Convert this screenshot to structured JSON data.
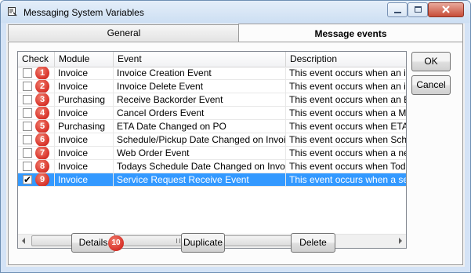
{
  "window": {
    "title": "Messaging System Variables"
  },
  "tabs": [
    {
      "label": "General",
      "active": false
    },
    {
      "label": "Message events",
      "active": true
    }
  ],
  "grid": {
    "columns": [
      "Check",
      "Module",
      "Event",
      "Description"
    ],
    "rows": [
      {
        "checked": false,
        "badge": "1",
        "module": "Invoice",
        "event": "Invoice Creation Event",
        "description": "This event occurs when an inv",
        "selected": false
      },
      {
        "checked": false,
        "badge": "2",
        "module": "Invoice",
        "event": "Invoice Delete Event",
        "description": "This event occurs when an inv",
        "selected": false
      },
      {
        "checked": false,
        "badge": "3",
        "module": "Purchasing",
        "event": "Receive Backorder Event",
        "description": "This event occurs when an Ba",
        "selected": false
      },
      {
        "checked": false,
        "badge": "4",
        "module": "Invoice",
        "event": "Cancel Orders Event",
        "description": "This event occurs when a Mo.",
        "selected": false
      },
      {
        "checked": false,
        "badge": "5",
        "module": "Purchasing",
        "event": "ETA Date Changed on PO",
        "description": "This event occurs when ETA .",
        "selected": false
      },
      {
        "checked": false,
        "badge": "6",
        "module": "Invoice",
        "event": "Schedule/Pickup Date Changed on Invoice",
        "description": "This event occurs when Sche.",
        "selected": false
      },
      {
        "checked": false,
        "badge": "7",
        "module": "Invoice",
        "event": "Web Order Event",
        "description": "This event occurs when a new",
        "selected": false
      },
      {
        "checked": false,
        "badge": "8",
        "module": "Invoice",
        "event": "Todays Schedule Date Changed on Invoice",
        "description": "This event occurs when Toda.",
        "selected": false
      },
      {
        "checked": true,
        "badge": "9",
        "module": "Invoice",
        "event": "Service Request Receive Event",
        "description": "This event occurs when a serv",
        "selected": true
      }
    ]
  },
  "buttons": {
    "ok": "OK",
    "cancel": "Cancel",
    "details": "Details",
    "details_badge": "10",
    "duplicate": "Duplicate",
    "delete": "Delete"
  },
  "colors": {
    "selection": "#3399ff",
    "badge": "#d9342b"
  }
}
